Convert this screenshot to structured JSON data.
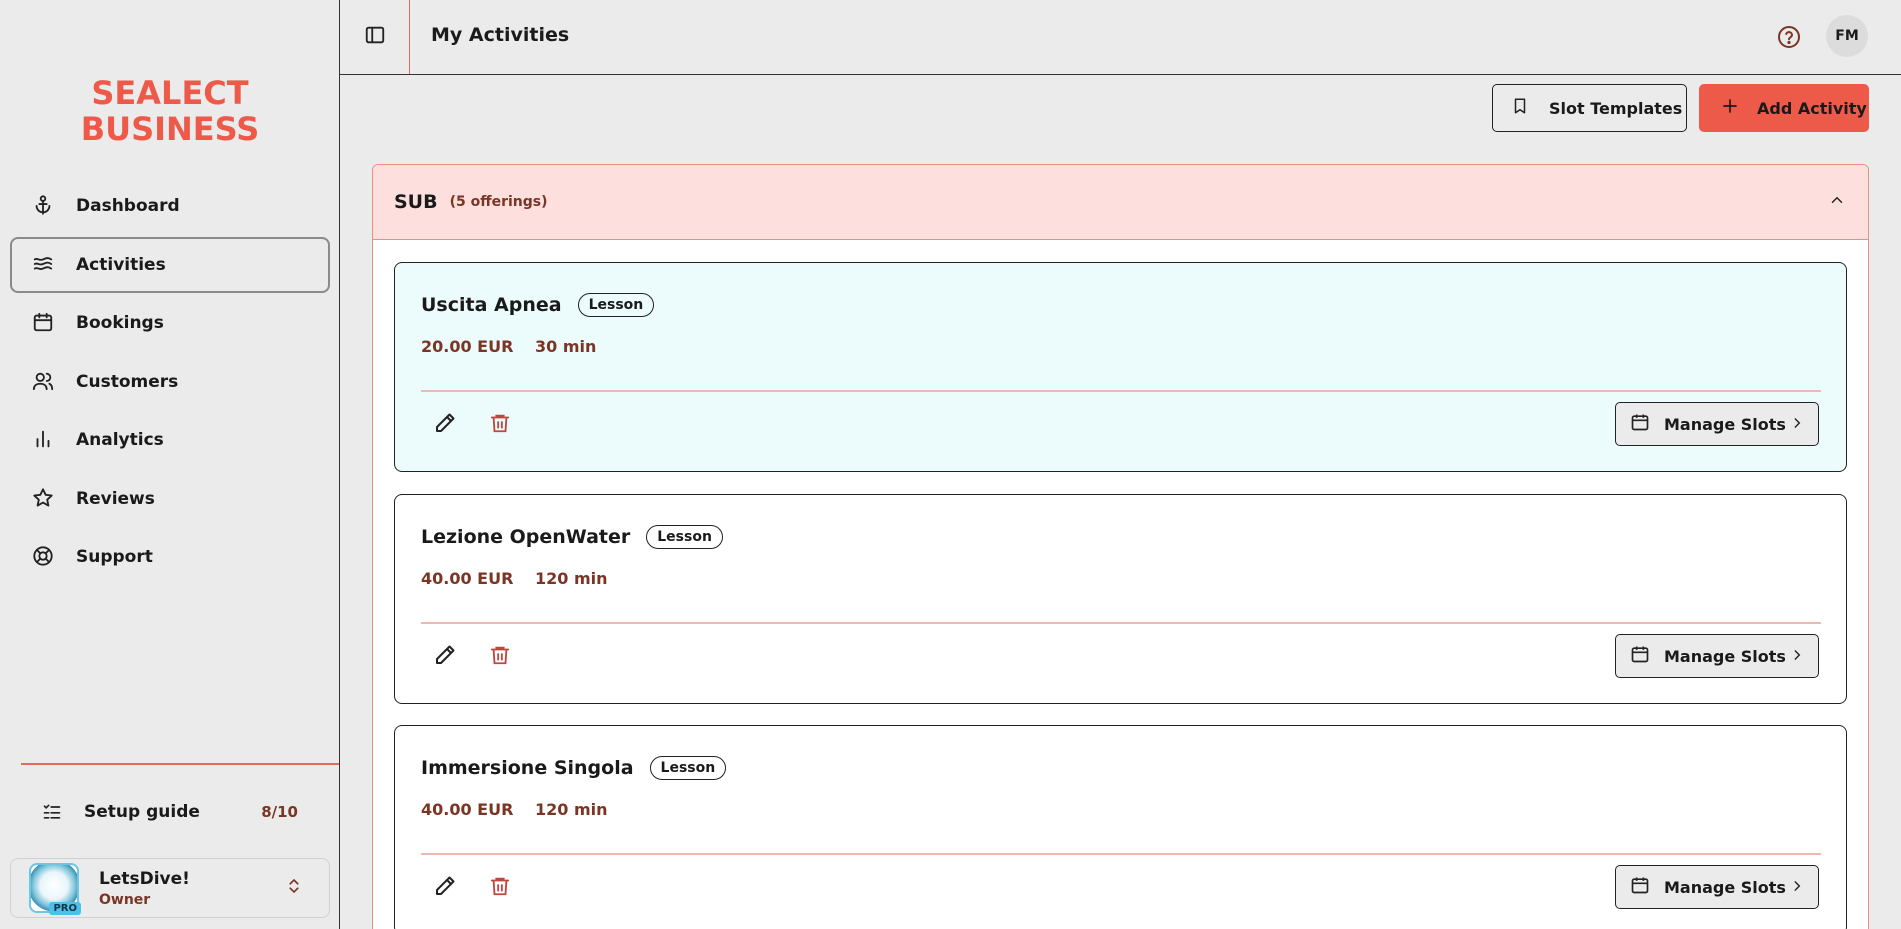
{
  "brand": {
    "logo_line1": "SEALECT",
    "logo_line2": "BUSINESS",
    "accent_color": "#ee5a4a"
  },
  "sidebar": {
    "items": [
      {
        "label": "Dashboard",
        "icon": "anchor-icon"
      },
      {
        "label": "Activities",
        "icon": "waves-icon",
        "active": true
      },
      {
        "label": "Bookings",
        "icon": "calendar-icon"
      },
      {
        "label": "Customers",
        "icon": "users-icon"
      },
      {
        "label": "Analytics",
        "icon": "bar-chart-icon"
      },
      {
        "label": "Reviews",
        "icon": "star-icon"
      },
      {
        "label": "Support",
        "icon": "lifebuoy-icon"
      }
    ],
    "setup_guide": {
      "label": "Setup guide",
      "progress": "8/10"
    },
    "account": {
      "name": "LetsDive!",
      "role": "Owner",
      "badge": "PRO"
    }
  },
  "header": {
    "title": "My Activities",
    "user_initials": "FM"
  },
  "toolbar": {
    "slot_templates_label": "Slot Templates",
    "add_activity_label": "Add Activity"
  },
  "category": {
    "name": "SUB",
    "count": "(5 offerings)",
    "activities": [
      {
        "name": "Uscita Apnea",
        "type": "Lesson",
        "price": "20.00 EUR",
        "duration": "30 min",
        "manage_label": "Manage Slots"
      },
      {
        "name": "Lezione OpenWater",
        "type": "Lesson",
        "price": "40.00 EUR",
        "duration": "120 min",
        "manage_label": "Manage Slots"
      },
      {
        "name": "Immersione Singola",
        "type": "Lesson",
        "price": "40.00 EUR",
        "duration": "120 min",
        "manage_label": "Manage Slots"
      }
    ]
  }
}
